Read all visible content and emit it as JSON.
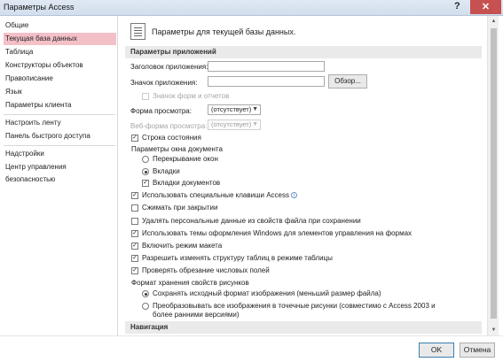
{
  "window": {
    "title": "Параметры Access",
    "help": "?",
    "close": "✕"
  },
  "nav": {
    "items": [
      {
        "label": "Общие"
      },
      {
        "label": "Текущая база данных"
      },
      {
        "label": "Таблица"
      },
      {
        "label": "Конструкторы объектов"
      },
      {
        "label": "Правописание"
      },
      {
        "label": "Язык"
      },
      {
        "label": "Параметры клиента"
      },
      {
        "label": "Настроить ленту"
      },
      {
        "label": "Панель быстрого доступа"
      },
      {
        "label": "Надстройки"
      },
      {
        "label": "Центр управления безопасностью"
      }
    ],
    "active_index": 1
  },
  "header": {
    "text": "Параметры для текущей базы данных."
  },
  "sections": {
    "app_options": "Параметры приложений",
    "navigation": "Навигация"
  },
  "app": {
    "title_label": "Заголовок приложения:",
    "title_value": "",
    "icon_label": "Значок приложения:",
    "icon_value": "",
    "browse_button": "Обзор...",
    "icon_for_forms_label": "Значок форм и отчетов",
    "display_form_label": "Форма просмотра:",
    "display_form_value": "(отсутствует)",
    "web_form_label": "Веб-форма просмотра:",
    "web_form_value": "(отсутствует)",
    "status_bar_label": "Строка состояния",
    "doc_window_label": "Параметры окна документа",
    "overlapping_label": "Перекрывание окон",
    "tabbed_label": "Вкладки",
    "doc_tabs_label": "Вкладки документов",
    "access_keys_label": "Использовать специальные клавиши Access",
    "compact_label": "Сжимать при закрытии",
    "remove_personal_label": "Удалять персональные данные из свойств файла при сохранении",
    "windows_themes_label": "Использовать темы оформления Windows для элементов управления на формах",
    "layout_view_label": "Включить режим макета",
    "design_changes_label": "Разрешить изменять структуру таблиц в режиме таблицы",
    "truncated_label": "Проверять обрезание числовых полей",
    "picture_format_label": "Формат хранения свойств рисунков",
    "preserve_format_label": "Сохранять исходный формат изображения (меньший размер файла)",
    "convert_bitmap_label": "Преобразовывать все изображения в точечные рисунки (совместимо с Access 2003 и более ранними версиями)"
  },
  "checks": {
    "icon_for_forms": false,
    "status_bar": true,
    "doc_tabs": true,
    "access_keys": true,
    "compact": false,
    "remove_personal": false,
    "windows_themes": true,
    "layout_view": true,
    "design_changes": true,
    "truncated": true
  },
  "radios": {
    "document_window": "tabbed",
    "picture_format": "preserve"
  },
  "footer": {
    "ok": "OK",
    "cancel": "Отмена"
  }
}
